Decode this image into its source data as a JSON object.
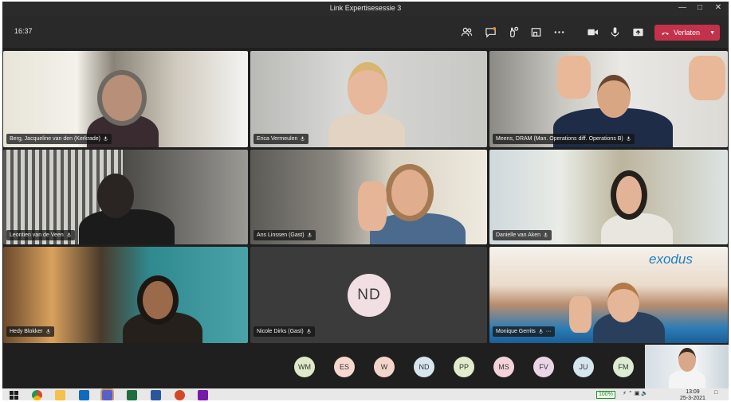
{
  "window": {
    "title": "Link Expertisesessie 3",
    "controls": [
      "minimize",
      "maximize",
      "close"
    ]
  },
  "meeting_bar": {
    "timer": "16:37",
    "buttons": [
      {
        "name": "participants-icon"
      },
      {
        "name": "chat-icon"
      },
      {
        "name": "reactions-icon"
      },
      {
        "name": "rooms-icon"
      },
      {
        "name": "more-icon"
      },
      {
        "name": "camera-icon"
      },
      {
        "name": "mic-icon"
      },
      {
        "name": "share-icon"
      }
    ],
    "leave_label": "Verlaten"
  },
  "participants": [
    {
      "name": "Berg, Jacqueline van den (Kerkrade)"
    },
    {
      "name": "Erica Vermeulen"
    },
    {
      "name": "Meens, DRAM (Man. Operations diff. Operations B)"
    },
    {
      "name": "Leontien van de Veen"
    },
    {
      "name": "Ans Linssen (Gast)"
    },
    {
      "name": "Danielle van Aken"
    },
    {
      "name": "Hedy Blokker"
    },
    {
      "name": "Nicole Dirks (Gast)",
      "initials": "ND"
    },
    {
      "name": "Monique Gerrits",
      "more": "···",
      "banner": "exodus"
    }
  ],
  "overflow_participants": [
    {
      "initials": "WM",
      "color": "#dfe8c8"
    },
    {
      "initials": "ES",
      "color": "#f6d8cf"
    },
    {
      "initials": "W",
      "color": "#f3d5cc"
    },
    {
      "initials": "ND",
      "color": "#d7e5ef"
    },
    {
      "initials": "PP",
      "color": "#e2ebcc"
    },
    {
      "initials": "MS",
      "color": "#f3d3d9"
    },
    {
      "initials": "FV",
      "color": "#ead5e6"
    },
    {
      "initials": "JU",
      "color": "#d6e6ee"
    },
    {
      "initials": "FM",
      "color": "#dcebd2"
    }
  ],
  "taskbar": {
    "apps": [
      "windows-start-icon",
      "chrome-icon",
      "file-explorer-icon",
      "outlook-icon",
      "teams-icon",
      "excel-icon",
      "word-icon",
      "powerpoint-icon",
      "onenote-icon"
    ],
    "battery": "100%",
    "time": "13:09",
    "date": "25-3-2021"
  },
  "colors": {
    "leave_button": "#c4314b",
    "meeting_bar": "#292929",
    "stage": "#1f1f1f"
  }
}
